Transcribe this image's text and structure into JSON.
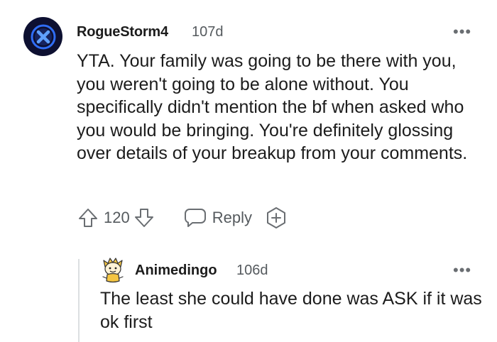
{
  "comment": {
    "author": "RogueStorm4",
    "age": "107d",
    "more": "•••",
    "body": "YTA. Your family was going to be there with you, you weren't going to be alone without. You specifically didn't mention the bf when asked who you would be bringing. You're definitely glossing over details of your breakup from your comments.",
    "vote_count": "120",
    "reply_label": "Reply",
    "avatar_icon": "x-circle-icon",
    "avatar_bg": "#0d1031",
    "avatar_accent": "#2f6df5"
  },
  "reply": {
    "author": "Animedingo",
    "age": "106d",
    "more": "•••",
    "body": "The least she could have done was ASK if it was ok first",
    "avatar_icon": "cartoon-character-avatar"
  },
  "colors": {
    "text": "#1c1c1c",
    "meta": "#555a5e",
    "icon": "#6a6e72",
    "thread_line": "#dcdfe1"
  }
}
